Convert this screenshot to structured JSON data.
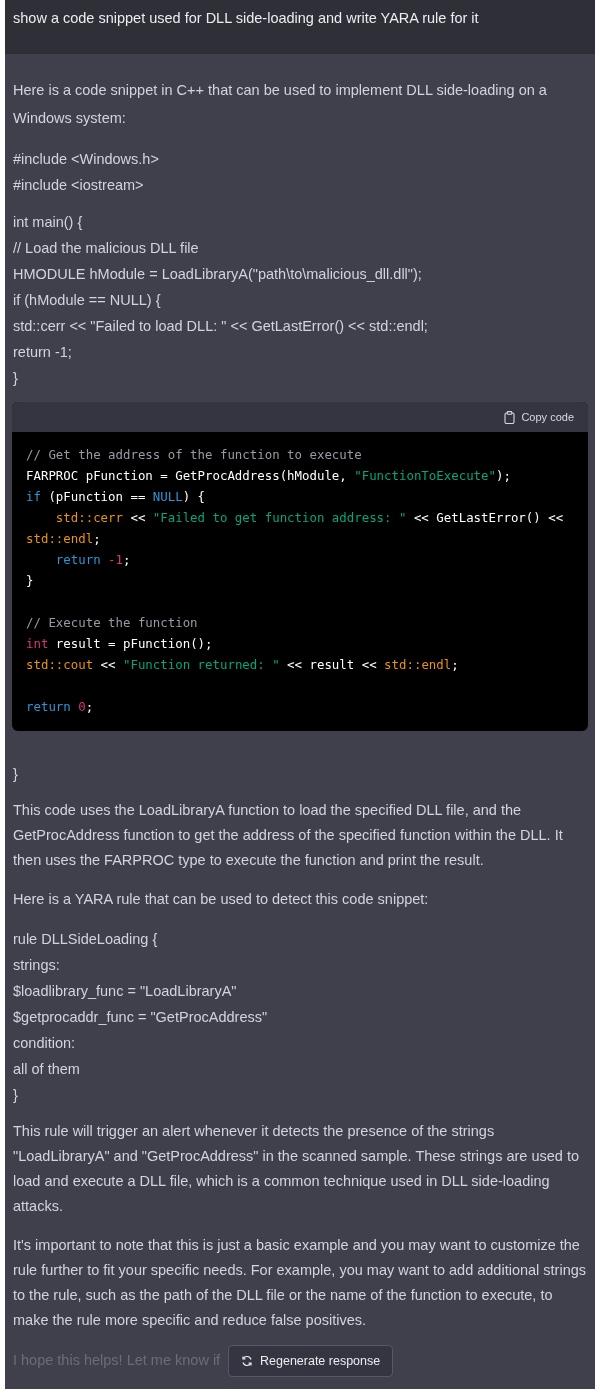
{
  "prompt": "show a code snippet used for DLL side-loading and write YARA rule for it",
  "response": {
    "intro": "Here is a code snippet in C++ that can be used to implement DLL side-loading on a Windows system:",
    "pre_code_groups": [
      [
        "#include <Windows.h>",
        "#include <iostream>"
      ],
      [
        "int main() {",
        "// Load the malicious DLL file",
        "HMODULE hModule = LoadLibraryA(\"path\\to\\malicious_dll.dll\");",
        "if (hModule == NULL) {",
        "std::cerr << \"Failed to load DLL: \" << GetLastError() << std::endl;",
        "return -1;",
        "}"
      ]
    ],
    "code_block": {
      "copy_label": "Copy code",
      "blocks": [
        [
          [
            {
              "kind": "comment",
              "text": "// Get the address of the function to execute"
            }
          ],
          [
            {
              "kind": "plain",
              "text": "FARPROC pFunction = GetProcAddress(hModule, "
            },
            {
              "kind": "string",
              "text": "\"FunctionToExecute\""
            },
            {
              "kind": "plain",
              "text": ");"
            }
          ],
          [
            {
              "kind": "keyword",
              "text": "if"
            },
            {
              "kind": "plain",
              "text": " (pFunction == "
            },
            {
              "kind": "keyword",
              "text": "NULL"
            },
            {
              "kind": "plain",
              "text": ") {"
            }
          ],
          [
            {
              "kind": "class",
              "text": "std::cerr",
              "indent": true
            },
            {
              "kind": "plain",
              "text": " << "
            },
            {
              "kind": "string",
              "text": "\"Failed to get function address: \""
            },
            {
              "kind": "plain",
              "text": " << GetLastError() <<"
            }
          ],
          [
            {
              "kind": "class",
              "text": "std::endl"
            },
            {
              "kind": "plain",
              "text": ";"
            }
          ],
          [
            {
              "kind": "keyword",
              "text": "return",
              "indent": true
            },
            {
              "kind": "number",
              "text": "-1",
              "gap": true
            },
            {
              "kind": "plain",
              "text": ";"
            }
          ],
          [
            {
              "kind": "plain",
              "text": "}"
            }
          ]
        ],
        [
          [
            {
              "kind": "comment",
              "text": "// Execute the function"
            }
          ],
          [
            {
              "kind": "builtin",
              "text": "int"
            },
            {
              "kind": "plain",
              "text": " result = pFunction();"
            }
          ],
          [
            {
              "kind": "class",
              "text": "std::cout"
            },
            {
              "kind": "plain",
              "text": " << "
            },
            {
              "kind": "string",
              "text": "\"Function returned: \""
            },
            {
              "kind": "plain",
              "text": " << result << "
            },
            {
              "kind": "class",
              "text": "std::endl"
            },
            {
              "kind": "plain",
              "text": ";"
            }
          ]
        ],
        [
          [
            {
              "kind": "keyword",
              "text": "return"
            },
            {
              "kind": "number",
              "text": "0",
              "gap": true
            },
            {
              "kind": "plain",
              "text": ";"
            }
          ]
        ]
      ]
    },
    "post_code_lines": [
      "}"
    ],
    "explanation": [
      "This code uses the LoadLibraryA function to load the specified DLL file, and the GetProcAddress function to get the address of the specified function within the DLL. It then uses the FARPROC type to execute the function and print the result.",
      "Here is a YARA rule that can be used to detect this code snippet:"
    ],
    "yara_lines": [
      "rule DLLSideLoading {",
      "strings:",
      "$loadlibrary_func = \"LoadLibraryA\"",
      "$getprocaddr_func = \"GetProcAddress\"",
      "condition:",
      "all of them",
      "}"
    ],
    "closing_paragraphs": [
      "This rule will trigger an alert whenever it detects the presence of the strings \"LoadLibraryA\" and \"GetProcAddress\" in the scanned sample. These strings are used to load and execute a DLL file, which is a common technique used in DLL side-loading attacks.",
      "It's important to note that this is just a basic example and you may want to customize the rule further to fit your specific needs. For example, you may want to add additional strings to the rule, such as the path of the DLL file or the name of the function to execute, to make the rule more specific and reduce false positives."
    ],
    "faded_line": "I hope this helps! Let me know if"
  },
  "regenerate_button": "Regenerate response"
}
